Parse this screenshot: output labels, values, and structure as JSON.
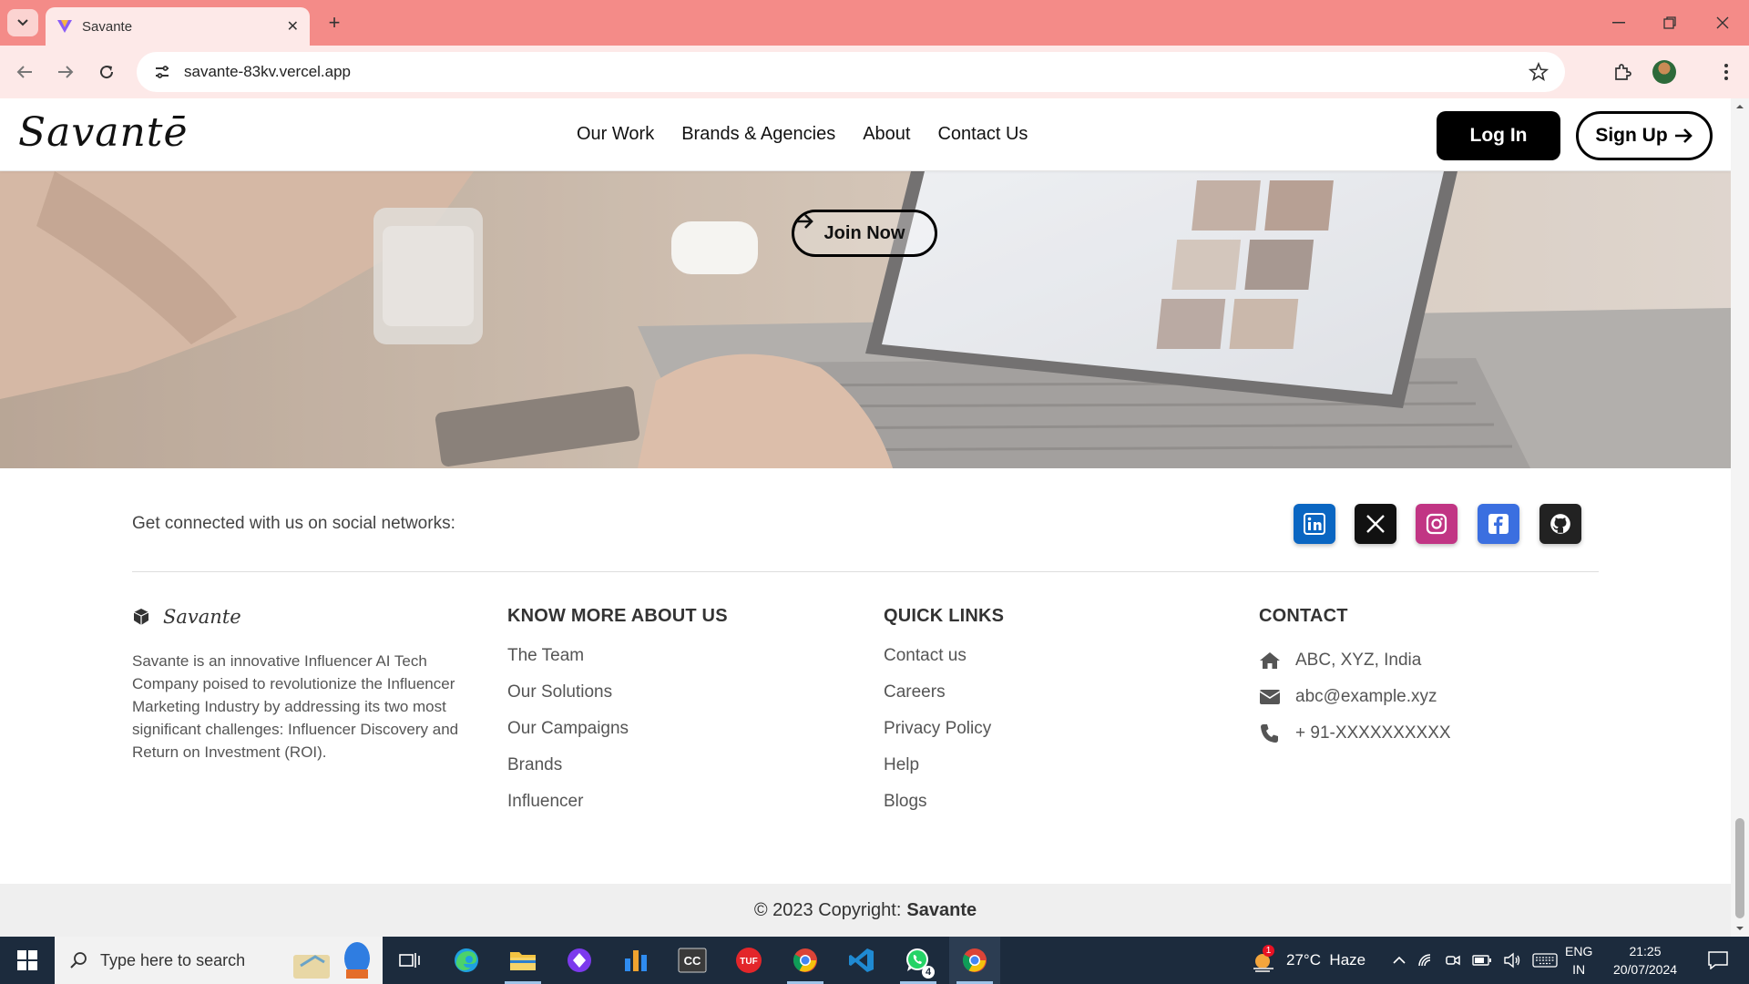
{
  "browser": {
    "tab_title": "Savante",
    "url": "savante-83kv.vercel.app"
  },
  "site": {
    "logo": "Savantē",
    "nav": [
      "Our Work",
      "Brands & Agencies",
      "About",
      "Contact Us"
    ],
    "login_label": "Log In",
    "signup_label": "Sign Up",
    "join_label": "Join Now"
  },
  "social": {
    "text": "Get connected with us on social networks:",
    "icons": [
      "linkedin-icon",
      "x-icon",
      "instagram-icon",
      "facebook-icon",
      "github-icon"
    ],
    "colors": {
      "linkedin": "#0a66c2",
      "x": "#111111",
      "instagram": "#c13584",
      "facebook": "#3b5998",
      "github": "#222222"
    }
  },
  "footer": {
    "brand_name": "Savante",
    "about": "Savante is an innovative Influencer AI Tech Company poised to revolutionize the Influencer Marketing Industry by addressing its two most significant challenges: Influencer Discovery and Return on Investment (ROI).",
    "know_more": {
      "title": "KNOW MORE ABOUT US",
      "links": [
        "The Team",
        "Our Solutions",
        "Our Campaigns",
        "Brands",
        "Influencer"
      ]
    },
    "quick_links": {
      "title": "QUICK LINKS",
      "links": [
        "Contact us",
        "Careers",
        "Privacy Policy",
        "Help",
        "Blogs"
      ]
    },
    "contact": {
      "title": "CONTACT",
      "address": "ABC, XYZ, India",
      "email": "abc@example.xyz",
      "phone": "+ 91-XXXXXXXXXX"
    },
    "copyright_prefix": "© 2023 Copyright:",
    "copyright_brand": "Savante"
  },
  "taskbar": {
    "search_placeholder": "Type here to search",
    "weather": "27°C  Haze",
    "weather_badge": "1",
    "lang_top": "ENG",
    "lang_bottom": "IN",
    "time": "21:25",
    "date": "20/07/2024",
    "whatsapp_badge": "4"
  }
}
